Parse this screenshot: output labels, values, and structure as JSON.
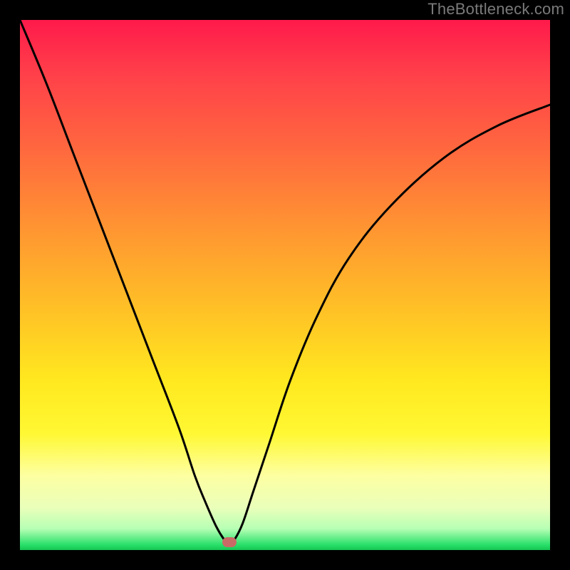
{
  "watermark": "TheBottleneck.com",
  "marker": {
    "x_frac": 0.395,
    "y_frac": 0.985,
    "color": "#c96a66"
  },
  "chart_data": {
    "type": "line",
    "title": "",
    "xlabel": "",
    "ylabel": "",
    "xlim": [
      0,
      100
    ],
    "ylim": [
      0,
      100
    ],
    "grid": false,
    "legend": false,
    "series": [
      {
        "name": "bottleneck-curve",
        "x": [
          0,
          5,
          10,
          15,
          20,
          25,
          30,
          33,
          35,
          37,
          38.5,
          39.5,
          40.5,
          42,
          44,
          47,
          51,
          56,
          62,
          70,
          80,
          90,
          100
        ],
        "y": [
          100,
          88,
          75,
          62,
          49,
          36,
          23,
          14,
          9,
          4.5,
          2,
          1,
          2,
          5,
          11,
          20,
          32,
          44,
          55,
          65,
          74,
          80,
          84
        ]
      }
    ],
    "annotations": [
      {
        "type": "marker",
        "x": 39.5,
        "y": 1.5,
        "label": "minimum"
      }
    ],
    "background_gradient": {
      "top": "#ff1a4b",
      "mid_upper": "#ff9731",
      "mid": "#ffe81f",
      "mid_lower": "#fdffa2",
      "bottom": "#15c553"
    }
  }
}
